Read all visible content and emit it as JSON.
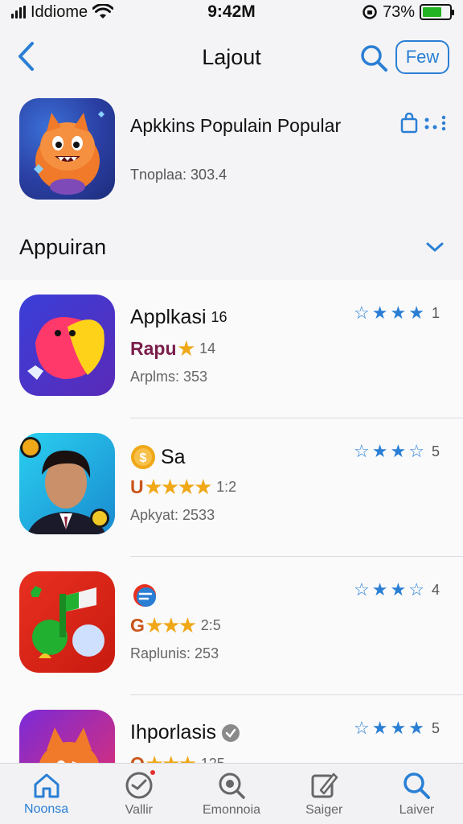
{
  "status": {
    "carrier": "Iddiome",
    "time": "9:42M",
    "battery_percent": "73%",
    "battery_level": 0.73
  },
  "nav": {
    "title": "Lajout",
    "pill_label": "Few"
  },
  "featured": {
    "title": "Apkkins Populain Popular",
    "meta": "Tnoplaa: 303.4"
  },
  "section": {
    "title": "Appuiran"
  },
  "apps": [
    {
      "name": "Applkasi",
      "name_badge": "16",
      "sub_prefix": "Rapu",
      "sub_color": "#7a1e4a",
      "sub_stars": "★",
      "sub_count": "14",
      "meta": "Arplms: 353",
      "rating_count": "1",
      "rating_filled": 4
    },
    {
      "name": "Sa",
      "name_badge": "",
      "sub_prefix": "U",
      "sub_color": "#c9551a",
      "sub_stars": "★★★★",
      "sub_count": "1:2",
      "meta": "Apkyat: 2533",
      "rating_count": "5",
      "rating_filled": 3
    },
    {
      "name": "",
      "name_badge": "",
      "sub_prefix": "G",
      "sub_color": "#c9551a",
      "sub_stars": "★★★",
      "sub_count": "2:5",
      "meta": "Raplunis: 253",
      "rating_count": "4",
      "rating_filled": 3
    },
    {
      "name": "Ihporlasis",
      "name_badge": "",
      "sub_prefix": "O",
      "sub_color": "#c9551a",
      "sub_stars": "★★★",
      "sub_count": "125",
      "meta": "",
      "rating_count": "5",
      "rating_filled": 4
    }
  ],
  "tabs": [
    {
      "label": "Noonsa",
      "icon": "home-icon",
      "active": true
    },
    {
      "label": "Vallir",
      "icon": "clock-icon",
      "active": false
    },
    {
      "label": "Emonnoia",
      "icon": "magnifier-icon",
      "active": false
    },
    {
      "label": "Saiger",
      "icon": "edit-icon",
      "active": false
    },
    {
      "label": "Laiver",
      "icon": "search-icon",
      "active": false
    }
  ],
  "colors": {
    "accent": "#2a7fd4",
    "star_gold": "#f0a818"
  }
}
